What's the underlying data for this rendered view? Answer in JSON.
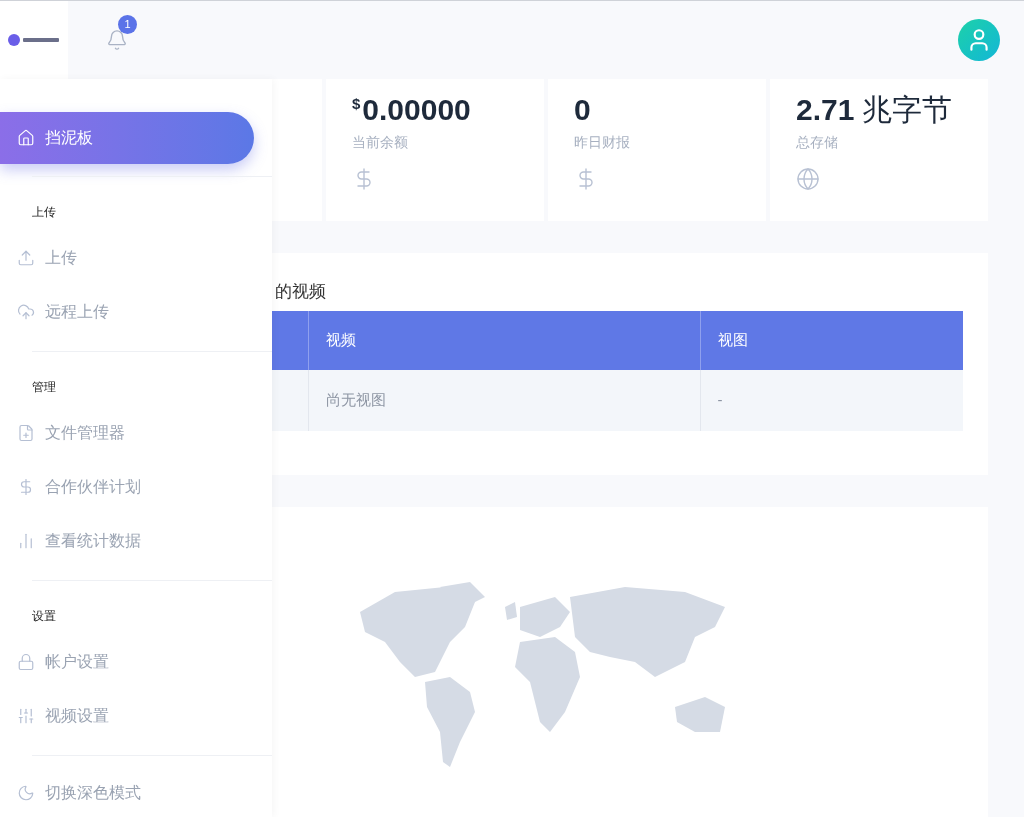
{
  "header": {
    "notification_count": "1"
  },
  "sidebar": {
    "sections": [
      {
        "items": [
          {
            "label": "挡泥板",
            "selected": true
          }
        ]
      },
      {
        "heading": "上传",
        "items": [
          {
            "label": "上传",
            "selected": false
          },
          {
            "label": "远程上传",
            "selected": false
          }
        ]
      },
      {
        "heading": "管理",
        "items": [
          {
            "label": "文件管理器",
            "selected": false
          },
          {
            "label": "合作伙伴计划",
            "selected": false
          },
          {
            "label": "查看统计数据",
            "selected": false
          }
        ]
      },
      {
        "heading": "设置",
        "items": [
          {
            "label": "帐户设置",
            "selected": false
          },
          {
            "label": "视频设置",
            "selected": false
          }
        ]
      },
      {
        "items": [
          {
            "label": "切换深色模式",
            "selected": false
          }
        ]
      }
    ]
  },
  "stats": [
    {
      "currency": "$",
      "value": "0.00000",
      "label": "当前余额"
    },
    {
      "value": "0",
      "label": "昨日财报"
    },
    {
      "value": "2.71",
      "unit": "兆字节",
      "label": "总存储"
    }
  ],
  "videos": {
    "title": "的视频",
    "columns": [
      "视频",
      "视图"
    ],
    "rows": [
      [
        "尚无视图",
        "-"
      ]
    ]
  }
}
